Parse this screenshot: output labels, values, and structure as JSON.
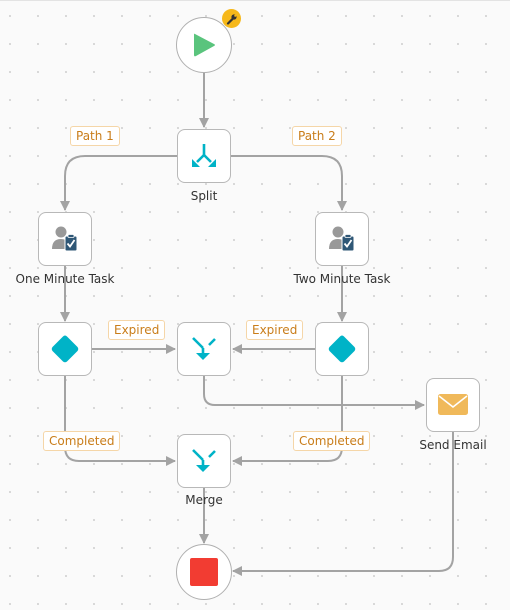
{
  "workflow": {
    "start": {
      "name": "start",
      "icon": "play-icon",
      "badge_icon": "wrench-icon"
    },
    "end": {
      "name": "end",
      "icon": "stop-icon"
    },
    "nodes": {
      "split": {
        "label": "Split",
        "icon": "split-icon"
      },
      "one_minute_task": {
        "label": "One Minute Task",
        "icon": "user-task-icon"
      },
      "two_minute_task": {
        "label": "Two Minute Task",
        "icon": "user-task-icon"
      },
      "decision_left": {
        "label": "",
        "icon": "diamond-icon"
      },
      "decision_right": {
        "label": "",
        "icon": "diamond-icon"
      },
      "join_expired": {
        "label": "",
        "icon": "merge-icon"
      },
      "merge": {
        "label": "Merge",
        "icon": "merge-icon"
      },
      "send_email": {
        "label": "Send Email",
        "icon": "envelope-icon"
      }
    },
    "edge_labels": {
      "path1": "Path 1",
      "path2": "Path 2",
      "expired_left": "Expired",
      "expired_right": "Expired",
      "completed_left": "Completed",
      "completed_right": "Completed"
    },
    "colors": {
      "accent": "#00b3c7",
      "start_green": "#5ac47d",
      "stop_red": "#f23c32",
      "email_yellow": "#f0b95a",
      "badge_yellow": "#f6b81a",
      "label_orange": "#c97d1a",
      "edge_gray": "#a3a3a3",
      "task_dark_blue": "#2f5776"
    }
  }
}
